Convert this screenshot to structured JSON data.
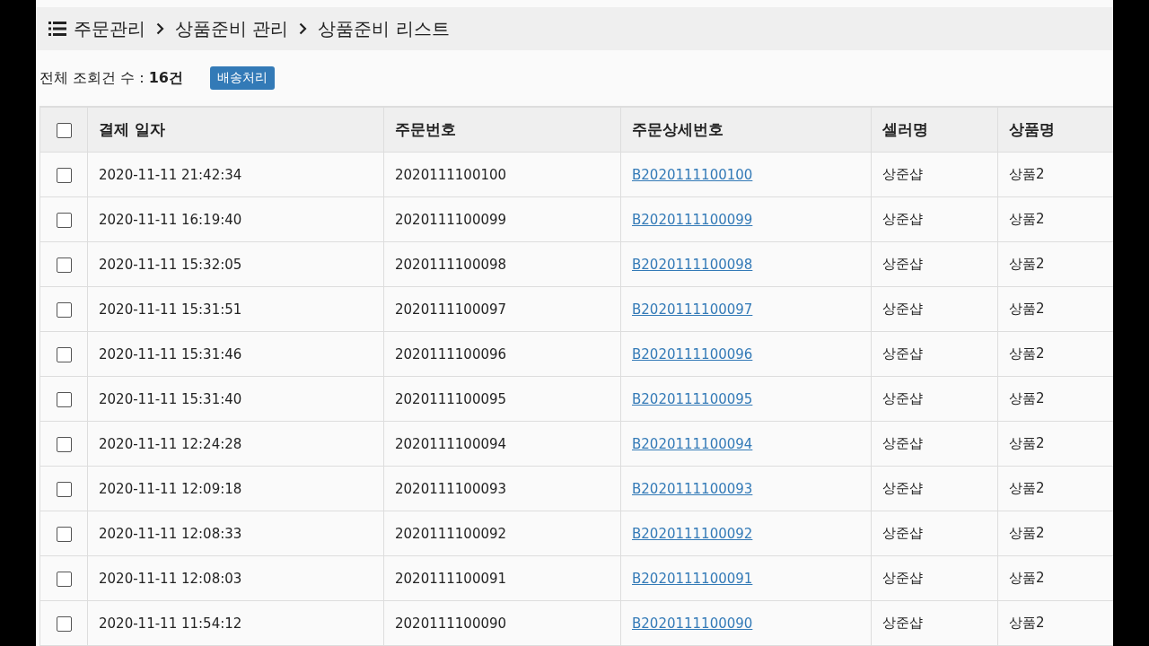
{
  "breadcrumb": [
    "주문관리",
    "상품준비 관리",
    "상품준비 리스트"
  ],
  "summary": "전체 조회건 수 : **16건**",
  "action_button": "배송처리",
  "table": {
    "select_all": {
      "checked": false
    },
    "columns": [
      "결제 일자",
      "주문번호",
      "주문상세번호",
      "셀러명",
      "상품명"
    ],
    "rows": [
      {
        "checked": false,
        "paid_at": "2020-11-11 21:42:34",
        "order_no": "2020111100100",
        "detail_no": "B2020111100100",
        "seller": "상준샵",
        "product": "상품2"
      },
      {
        "checked": false,
        "paid_at": "2020-11-11 16:19:40",
        "order_no": "2020111100099",
        "detail_no": "B2020111100099",
        "seller": "상준샵",
        "product": "상품2"
      },
      {
        "checked": false,
        "paid_at": "2020-11-11 15:32:05",
        "order_no": "2020111100098",
        "detail_no": "B2020111100098",
        "seller": "상준샵",
        "product": "상품2"
      },
      {
        "checked": false,
        "paid_at": "2020-11-11 15:31:51",
        "order_no": "2020111100097",
        "detail_no": "B2020111100097",
        "seller": "상준샵",
        "product": "상품2"
      },
      {
        "checked": false,
        "paid_at": "2020-11-11 15:31:46",
        "order_no": "2020111100096",
        "detail_no": "B2020111100096",
        "seller": "상준샵",
        "product": "상품2"
      },
      {
        "checked": false,
        "paid_at": "2020-11-11 15:31:40",
        "order_no": "2020111100095",
        "detail_no": "B2020111100095",
        "seller": "상준샵",
        "product": "상품2"
      },
      {
        "checked": false,
        "paid_at": "2020-11-11 12:24:28",
        "order_no": "2020111100094",
        "detail_no": "B2020111100094",
        "seller": "상준샵",
        "product": "상품2"
      },
      {
        "checked": false,
        "paid_at": "2020-11-11 12:09:18",
        "order_no": "2020111100093",
        "detail_no": "B2020111100093",
        "seller": "상준샵",
        "product": "상품2"
      },
      {
        "checked": false,
        "paid_at": "2020-11-11 12:08:33",
        "order_no": "2020111100092",
        "detail_no": "B2020111100092",
        "seller": "상준샵",
        "product": "상품2"
      },
      {
        "checked": false,
        "paid_at": "2020-11-11 12:08:03",
        "order_no": "2020111100091",
        "detail_no": "B2020111100091",
        "seller": "상준샵",
        "product": "상품2"
      },
      {
        "checked": false,
        "paid_at": "2020-11-11 11:54:12",
        "order_no": "2020111100090",
        "detail_no": "B2020111100090",
        "seller": "상준샵",
        "product": "상품2"
      }
    ]
  }
}
